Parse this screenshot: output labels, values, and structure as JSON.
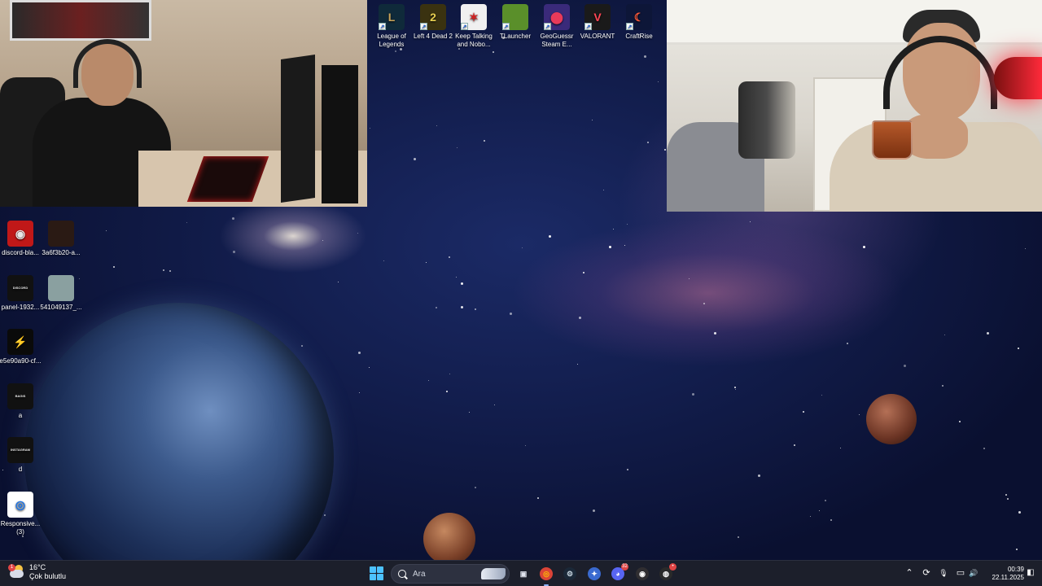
{
  "desktop_top_icons": [
    {
      "label": "League of Legends",
      "icon": "league-of-legends-icon",
      "color": "#0f2a3a",
      "accent": "#c8a45a",
      "glyph": "L"
    },
    {
      "label": "Left 4 Dead 2",
      "icon": "left-4-dead-2-icon",
      "color": "#3a3210",
      "accent": "#e8d050",
      "glyph": "2"
    },
    {
      "label": "Keep Talking and Nobo...",
      "icon": "keep-talking-icon",
      "color": "#f0f0f0",
      "accent": "#d02020",
      "glyph": "✶"
    },
    {
      "label": "TLauncher",
      "icon": "tlauncher-icon",
      "color": "#5a8f2a",
      "accent": "#7a5230",
      "glyph": ""
    },
    {
      "label": "GeoGuessr Steam E...",
      "icon": "geoguessr-icon",
      "color": "#3a2a7a",
      "accent": "#e83a5a",
      "glyph": "⬤"
    },
    {
      "label": "VALORANT",
      "icon": "valorant-icon",
      "color": "#1a1a1a",
      "accent": "#ff4655",
      "glyph": "V"
    },
    {
      "label": "CraftRise",
      "icon": "craftrise-icon",
      "color": "#0d1638",
      "accent": "#ff5a3a",
      "glyph": "☾"
    }
  ],
  "desktop_left_icons": [
    {
      "label": "discord-bla...",
      "icon": "discord-banner-icon",
      "color": "#c01818",
      "glyph": "◉"
    },
    {
      "label": "3a6f3b20-a...",
      "icon": "image-file-icon",
      "color": "#2a1a14",
      "glyph": ""
    },
    {
      "label": "panel-1932...",
      "icon": "discord-panel-icon",
      "color": "#111111",
      "glyph": "DISCORD"
    },
    {
      "label": "541049137_...",
      "icon": "photo-file-icon",
      "color": "#8aa0a0",
      "glyph": ""
    },
    {
      "label": "e5e90a90-cf...",
      "icon": "kick-logo-file-icon",
      "color": "#0a0a0a",
      "glyph": "⚡"
    },
    {
      "label": "a",
      "icon": "bagis-panel-icon",
      "color": "#111111",
      "glyph": "BAGIS"
    },
    {
      "label": "d",
      "icon": "instagram-panel-icon",
      "color": "#111111",
      "glyph": "INSTAGRAM"
    },
    {
      "label": "Responsive... (3)",
      "icon": "chrome-html-file-icon",
      "color": "#ffffff",
      "glyph": "◎"
    }
  ],
  "taskbar": {
    "weather_temp": "16°C",
    "weather_desc": "Çok bulutlu",
    "weather_badge": "1",
    "search_placeholder": "Ara",
    "apps": [
      {
        "name": "task-view",
        "icon": "task-view-icon",
        "glyph": "▣",
        "color": "#e0e4ee",
        "bg": "transparent"
      },
      {
        "name": "chrome",
        "icon": "chrome-icon",
        "glyph": "◎",
        "color": "#fbbc05",
        "bg": "#db4437",
        "active": true
      },
      {
        "name": "steam",
        "icon": "steam-icon",
        "glyph": "⚙",
        "color": "#c7d5e0",
        "bg": "#1b2838"
      },
      {
        "name": "xbox",
        "icon": "game-launcher-icon",
        "glyph": "✦",
        "color": "#fff",
        "bg": "#3a6ad0"
      },
      {
        "name": "discord",
        "icon": "discord-icon",
        "glyph": "◕",
        "color": "#fff",
        "bg": "#5865f2",
        "badge": "32"
      },
      {
        "name": "obs",
        "icon": "obs-icon",
        "glyph": "◉",
        "color": "#fff",
        "bg": "#302e31"
      },
      {
        "name": "streamlabs",
        "icon": "stream-app-icon",
        "glyph": "◍",
        "color": "#fff",
        "bg": "#2a2a2a",
        "badge": "•"
      }
    ],
    "tray": {
      "chevron": "⌃",
      "sync": "⟳",
      "mic": "🎙",
      "network": "▭",
      "volume": "🔊"
    },
    "time": "00:39",
    "date": "22.11.2025"
  }
}
